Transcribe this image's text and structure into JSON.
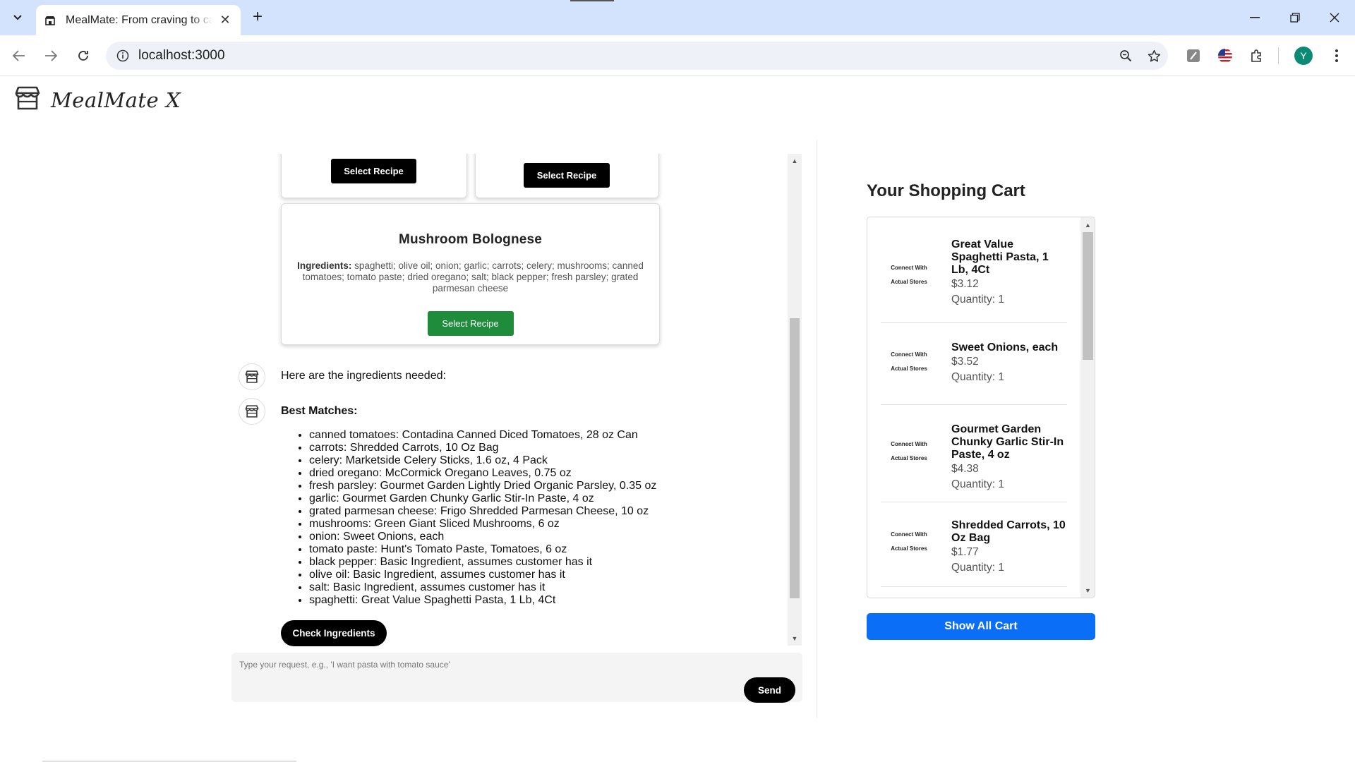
{
  "browser": {
    "tab_title": "MealMate: From craving to cart",
    "new_tab_symbol": "+",
    "tab_close_symbol": "✕",
    "url": "localhost:3000",
    "profile_initial": "Y",
    "window": {
      "minimize": "—",
      "restore": "❐",
      "close": "✕"
    }
  },
  "app": {
    "logo_text": "MealMate X"
  },
  "recipes": {
    "select_label": "Select Recipe",
    "featured": {
      "title": "Mushroom Bolognese",
      "ingredients_label": "Ingredients:",
      "ingredients_text": "spaghetti; olive oil; onion; garlic; carrots; celery; mushrooms; canned tomatoes; tomato paste; dried oregano; salt; black pepper; fresh parsley; grated parmesan cheese"
    }
  },
  "chat": {
    "ingredients_msg": "Here are the ingredients needed:",
    "best_matches_heading": "Best Matches:",
    "best_matches": [
      "canned tomatoes: Contadina Canned Diced Tomatoes, 28 oz Can",
      "carrots: Shredded Carrots, 10 Oz Bag",
      "celery: Marketside Celery Sticks, 1.6 oz, 4 Pack",
      "dried oregano: McCormick Oregano Leaves, 0.75 oz",
      "fresh parsley: Gourmet Garden Lightly Dried Organic Parsley, 0.35 oz",
      "garlic: Gourmet Garden Chunky Garlic Stir-In Paste, 4 oz",
      "grated parmesan cheese: Frigo Shredded Parmesan Cheese, 10 oz",
      "mushrooms: Green Giant Sliced Mushrooms, 6 oz",
      "onion: Sweet Onions, each",
      "tomato paste: Hunt's Tomato Paste, Tomatoes, 6 oz",
      "black pepper: Basic Ingredient, assumes customer has it",
      "olive oil: Basic Ingredient, assumes customer has it",
      "salt: Basic Ingredient, assumes customer has it",
      "spaghetti: Great Value Spaghetti Pasta, 1 Lb, 4Ct"
    ],
    "check_ingredients_label": "Check Ingredients",
    "input_placeholder": "Type your request, e.g., 'I want pasta with tomato sauce'",
    "send_label": "Send"
  },
  "cart": {
    "title": "Your Shopping Cart",
    "image_placeholder_line1": "Connect With",
    "image_placeholder_line2": "Actual Stores",
    "items": [
      {
        "name": "Great Value Spaghetti Pasta, 1 Lb, 4Ct",
        "price": "$3.12",
        "quantity": "Quantity: 1"
      },
      {
        "name": "Sweet Onions, each",
        "price": "$3.52",
        "quantity": "Quantity: 1"
      },
      {
        "name": "Gourmet Garden Chunky Garlic Stir-In Paste, 4 oz",
        "price": "$4.38",
        "quantity": "Quantity: 1"
      },
      {
        "name": "Shredded Carrots, 10 Oz Bag",
        "price": "$1.77",
        "quantity": "Quantity: 1"
      }
    ],
    "show_all_label": "Show All Cart"
  },
  "colors": {
    "tabbar_bg": "#d3e3fd",
    "select_green": "#1e8c3a",
    "show_all_blue": "#0b6ef7",
    "avatar_teal": "#0b8a75"
  }
}
